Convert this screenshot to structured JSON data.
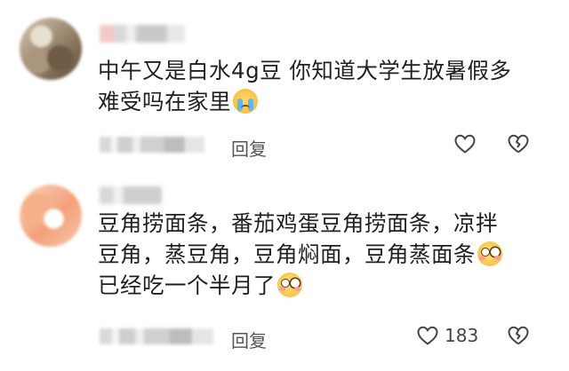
{
  "comments": [
    {
      "text_lines": [
        "中午又是白水4g豆 你知道大学生放暑假多",
        "难受吗在家里"
      ],
      "trailing_emoji": "loudly-crying-face",
      "reply_label": "回复",
      "like_count": ""
    },
    {
      "text_lines": [
        "豆角捞面条，番茄鸡蛋豆角捞面条，凉拌",
        "豆角，蒸豆角，豆角焖面，豆角蒸面条",
        "已经吃一个半月了"
      ],
      "line2_emoji": "flushed-face",
      "trailing_emoji": "flushed-face",
      "reply_label": "回复",
      "like_count": "183"
    }
  ]
}
